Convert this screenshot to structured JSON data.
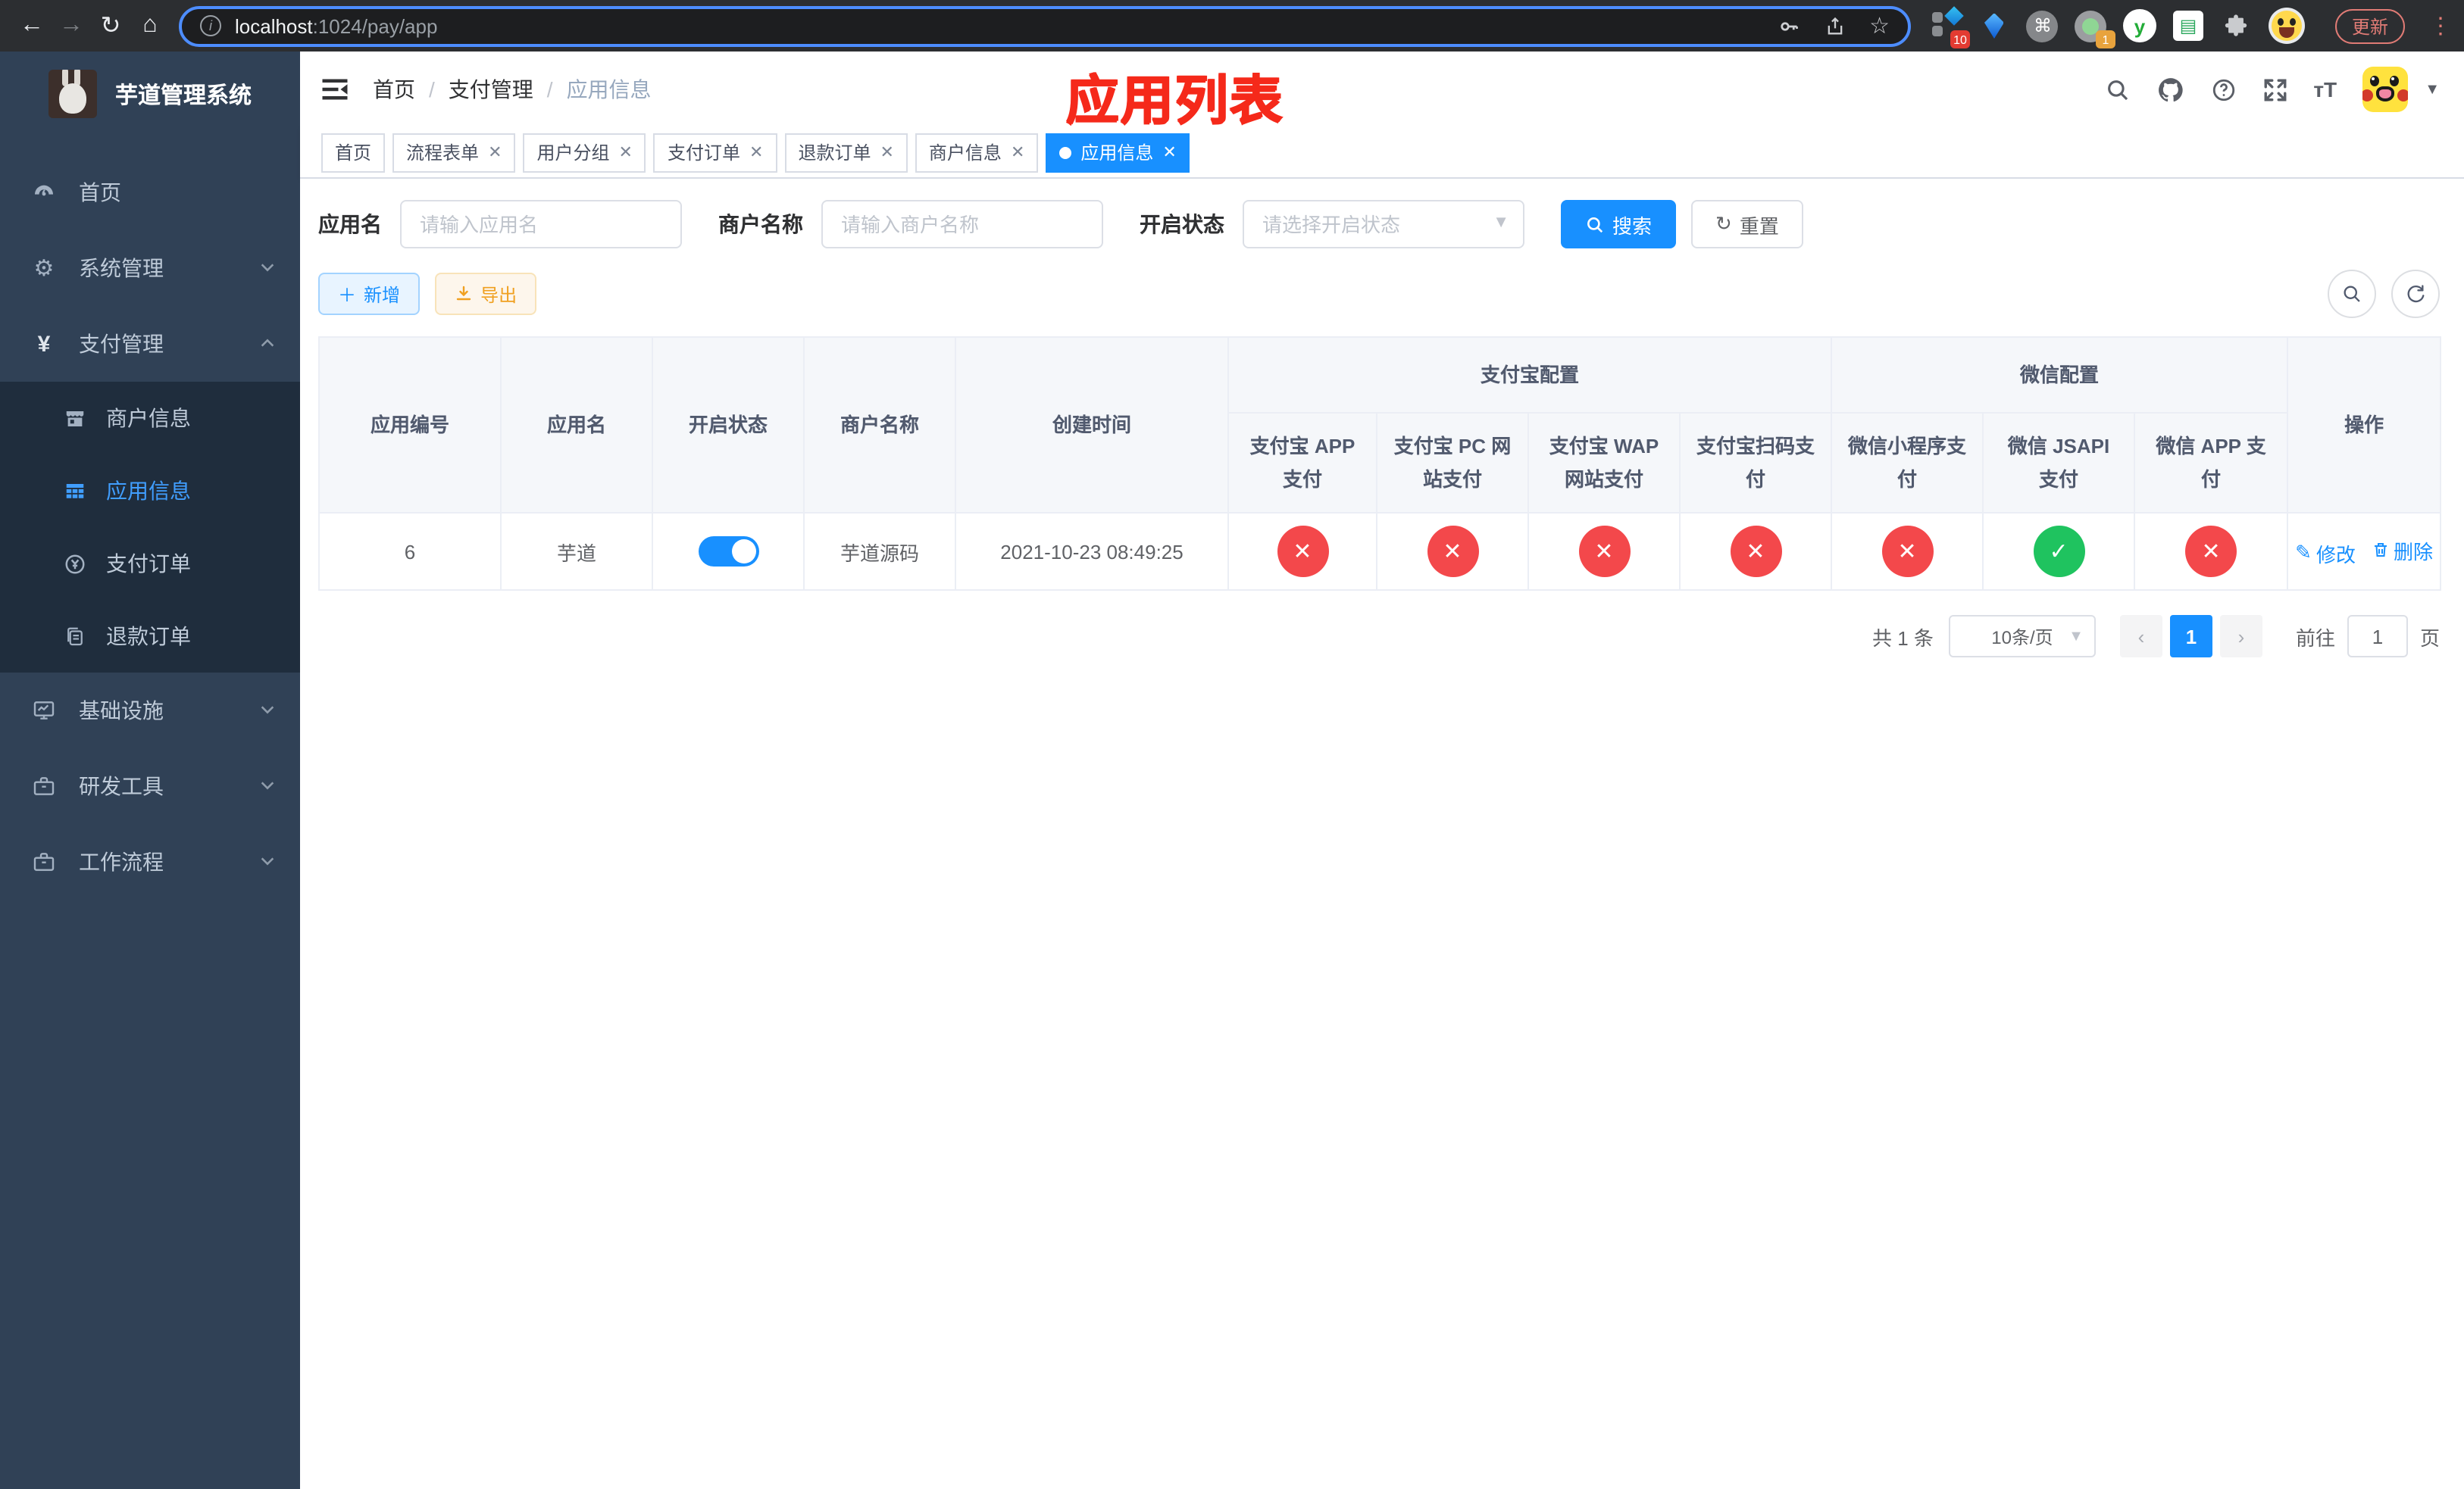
{
  "colors": {
    "primary": "#1890ff",
    "success": "#1fc35f",
    "danger": "#f3484b",
    "warning": "#f0a020",
    "sidebar_bg": "#304156",
    "submenu_bg": "#1f2d3d",
    "annotation_red": "#f5291a",
    "active_link": "#409eff"
  },
  "browser": {
    "url_host": "localhost",
    "url_path": ":1024/pay/app",
    "update_button": "更新",
    "ext_badge_blocks": "10",
    "ext_badge_cam": "1"
  },
  "sidebar": {
    "title": "芋道管理系统",
    "items": [
      {
        "label": "首页"
      },
      {
        "label": "系统管理"
      },
      {
        "label": "支付管理"
      },
      {
        "label": "商户信息"
      },
      {
        "label": "应用信息"
      },
      {
        "label": "支付订单"
      },
      {
        "label": "退款订单"
      },
      {
        "label": "基础设施"
      },
      {
        "label": "研发工具"
      },
      {
        "label": "工作流程"
      }
    ]
  },
  "breadcrumb": [
    {
      "label": "首页"
    },
    {
      "label": "支付管理"
    },
    {
      "label": "应用信息"
    }
  ],
  "annotation": "应用列表",
  "tabs": [
    {
      "label": "首页"
    },
    {
      "label": "流程表单"
    },
    {
      "label": "用户分组"
    },
    {
      "label": "支付订单"
    },
    {
      "label": "退款订单"
    },
    {
      "label": "商户信息"
    },
    {
      "label": "应用信息"
    }
  ],
  "filters": {
    "app_name_label": "应用名",
    "app_name_placeholder": "请输入应用名",
    "merchant_label": "商户名称",
    "merchant_placeholder": "请输入商户名称",
    "status_label": "开启状态",
    "status_placeholder": "请选择开启状态",
    "search_label": "搜索",
    "reset_label": "重置"
  },
  "toolbar": {
    "add_label": "新增",
    "export_label": "导出"
  },
  "table": {
    "columns": [
      {
        "label": "应用编号"
      },
      {
        "label": "应用名"
      },
      {
        "label": "开启状态"
      },
      {
        "label": "商户名称"
      },
      {
        "label": "创建时间"
      }
    ],
    "groups": [
      {
        "label": "支付宝配置"
      },
      {
        "label": "微信配置"
      }
    ],
    "sub_columns": [
      {
        "label": "支付宝 APP 支付"
      },
      {
        "label": "支付宝 PC 网站支付"
      },
      {
        "label": "支付宝 WAP 网站支付"
      },
      {
        "label": "支付宝扫码支付"
      },
      {
        "label": "微信小程序支付"
      },
      {
        "label": "微信 JSAPI 支付"
      },
      {
        "label": "微信 APP 支付"
      }
    ],
    "op_label": "操作",
    "row": {
      "id": "6",
      "name": "芋道",
      "enabled": true,
      "merchant": "芋道源码",
      "created": "2021-10-23 08:49:25",
      "statuses": [
        "fail",
        "fail",
        "fail",
        "fail",
        "fail",
        "success",
        "fail"
      ],
      "edit_label": "修改",
      "delete_label": "删除"
    }
  },
  "pagination": {
    "total": "共 1 条",
    "page_size": "10条/页",
    "page": "1",
    "goto_prefix": "前往",
    "goto_value": "1",
    "goto_suffix": "页"
  }
}
